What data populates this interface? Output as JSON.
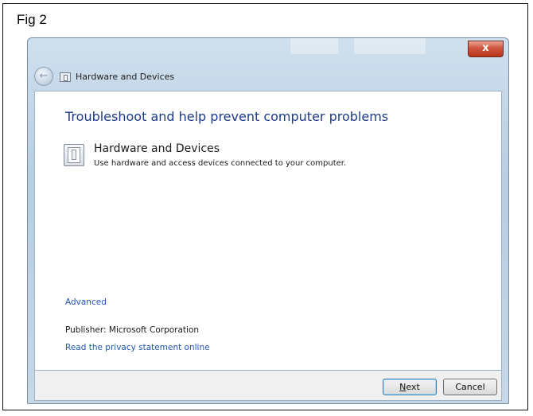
{
  "figure_label": "Fig 2",
  "window": {
    "title": "Hardware and Devices",
    "close_symbol": "x"
  },
  "content": {
    "heading": "Troubleshoot and help prevent computer problems",
    "item": {
      "title": "Hardware and Devices",
      "description": "Use hardware and access devices connected to your computer.",
      "icon": "hardware-device-icon"
    },
    "advanced_link": "Advanced",
    "publisher": "Publisher:  Microsoft Corporation",
    "privacy_link": "Read the privacy statement online"
  },
  "footer": {
    "next_label_first": "N",
    "next_label_rest": "ext",
    "cancel_label": "Cancel"
  },
  "colors": {
    "heading": "#1e3b8a",
    "link": "#1f56b2",
    "close_button": "#c74430"
  }
}
